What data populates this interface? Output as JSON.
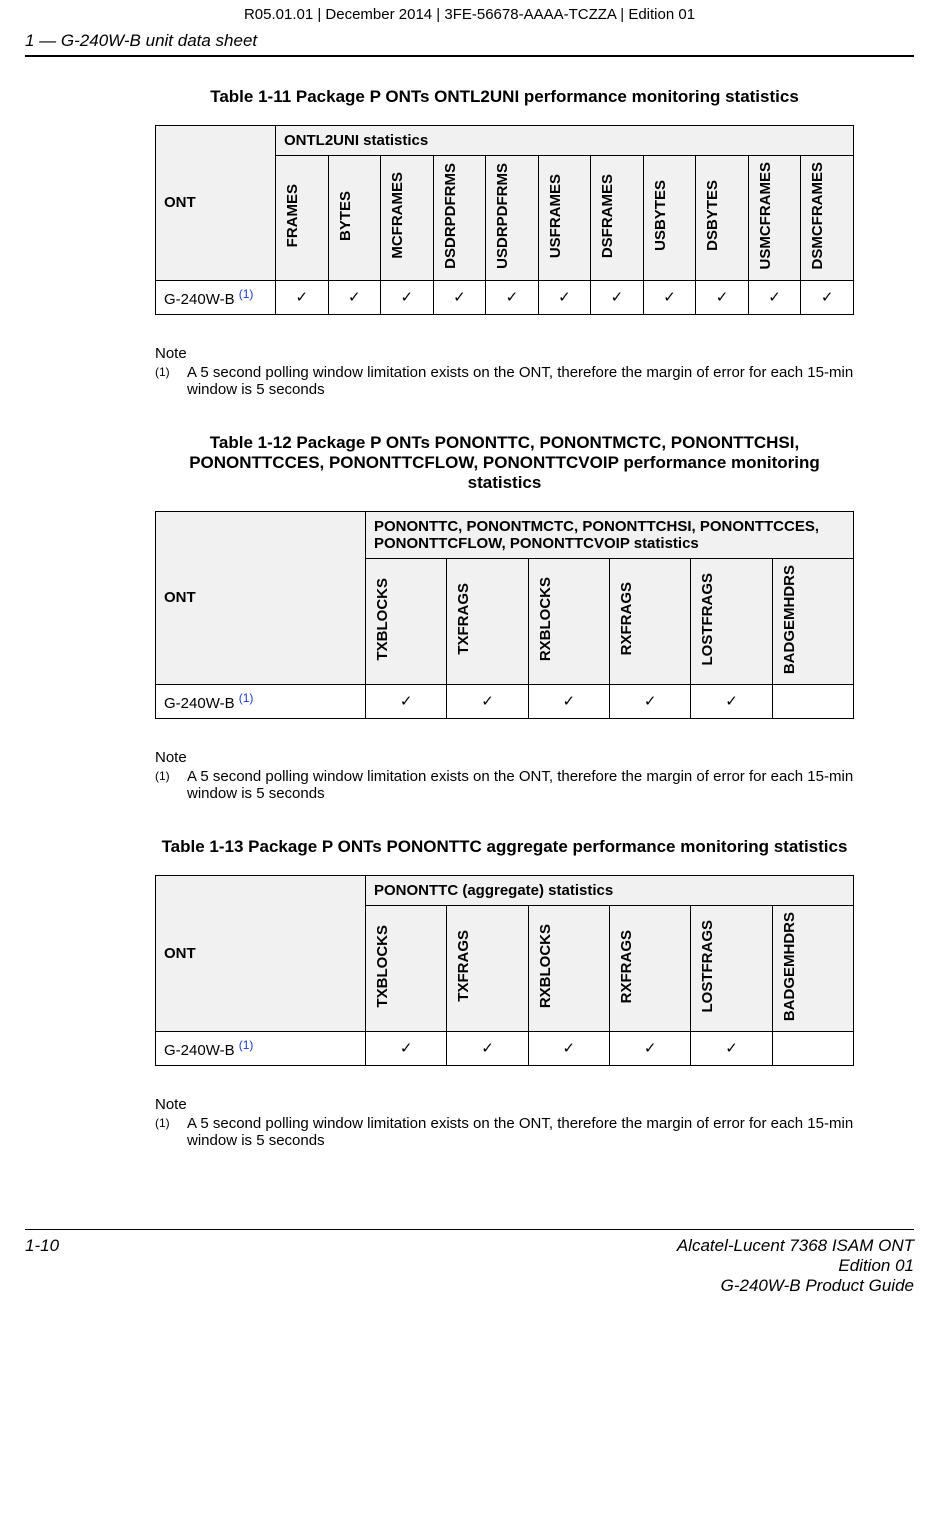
{
  "meta": {
    "top": "R05.01.01 | December 2014 | 3FE-56678-AAAA-TCZZA | Edition 01",
    "section": "1 —  G-240W-B unit data sheet"
  },
  "table11": {
    "title": "Table 1-11 Package P ONTs ONTL2UNI performance monitoring statistics",
    "ont_header": "ONT",
    "group_header": "ONTL2UNI statistics",
    "cols": [
      "FRAMES",
      "BYTES",
      "MCFRAMES",
      "DSDRPDFRMS",
      "USDRPDFRMS",
      "USFRAMES",
      "DSFRAMES",
      "USBYTES",
      "DSBYTES",
      "USMCFRAMES",
      "DSMCFRAMES"
    ],
    "row_label_prefix": "G-240W-B ",
    "row_foot": "(1)",
    "checks": [
      "✓",
      "✓",
      "✓",
      "✓",
      "✓",
      "✓",
      "✓",
      "✓",
      "✓",
      "✓",
      "✓"
    ]
  },
  "note11": {
    "label": "Note",
    "num": "(1)",
    "text": "A 5 second polling window limitation exists on the ONT, therefore the margin of error for each 15-min window is 5 seconds"
  },
  "table12": {
    "title": "Table 1-12 Package P ONTs PONONTTC, PONONTMCTC, PONONTTCHSI, PONONTTCCES, PONONTTCFLOW, PONONTTCVOIP performance monitoring statistics",
    "ont_header": "ONT",
    "group_header": "PONONTTC, PONONTMCTC, PONONTTCHSI, PONONTTCCES, PONONTTCFLOW, PONONTTCVOIP statistics",
    "cols": [
      "TXBLOCKS",
      "TXFRAGS",
      "RXBLOCKS",
      "RXFRAGS",
      "LOSTFRAGS",
      "BADGEMHDRS"
    ],
    "row_label_prefix": "G-240W-B ",
    "row_foot": "(1)",
    "checks": [
      "✓",
      "✓",
      "✓",
      "✓",
      "✓",
      ""
    ]
  },
  "note12": {
    "label": "Note",
    "num": "(1)",
    "text": "A 5 second polling window limitation exists on the ONT, therefore the margin of error for each 15-min window is 5 seconds"
  },
  "table13": {
    "title": "Table 1-13 Package P ONTs PONONTTC aggregate performance monitoring statistics",
    "ont_header": "ONT",
    "group_header": "PONONTTC (aggregate) statistics",
    "cols": [
      "TXBLOCKS",
      "TXFRAGS",
      "RXBLOCKS",
      "RXFRAGS",
      "LOSTFRAGS",
      "BADGEMHDRS"
    ],
    "row_label_prefix": "G-240W-B ",
    "row_foot": "(1)",
    "checks": [
      "✓",
      "✓",
      "✓",
      "✓",
      "✓",
      ""
    ]
  },
  "note13": {
    "label": "Note",
    "num": "(1)",
    "text": "A 5 second polling window limitation exists on the ONT, therefore the margin of error for each 15-min window is 5 seconds"
  },
  "footer": {
    "page_num": "1-10",
    "line1": "Alcatel-Lucent 7368 ISAM ONT",
    "line2": "Edition 01",
    "line3": "G-240W-B Product Guide"
  }
}
